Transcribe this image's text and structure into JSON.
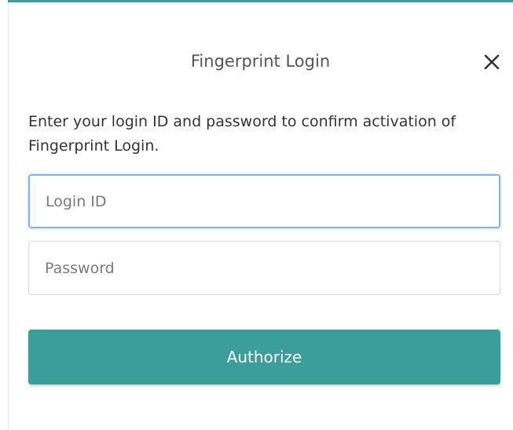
{
  "dialog": {
    "title": "Fingerprint Login",
    "close_icon": "close-icon",
    "instructions": "Enter your login ID and password to confirm activation of Fingerprint Login."
  },
  "form": {
    "login_id_placeholder": "Login ID",
    "login_id_value": "",
    "password_placeholder": "Password",
    "password_value": "",
    "authorize_label": "Authorize"
  },
  "colors": {
    "accent": "#3a9e9b",
    "focus_border": "#7fb4e6",
    "title_text": "#555555",
    "body_text": "#333333"
  }
}
